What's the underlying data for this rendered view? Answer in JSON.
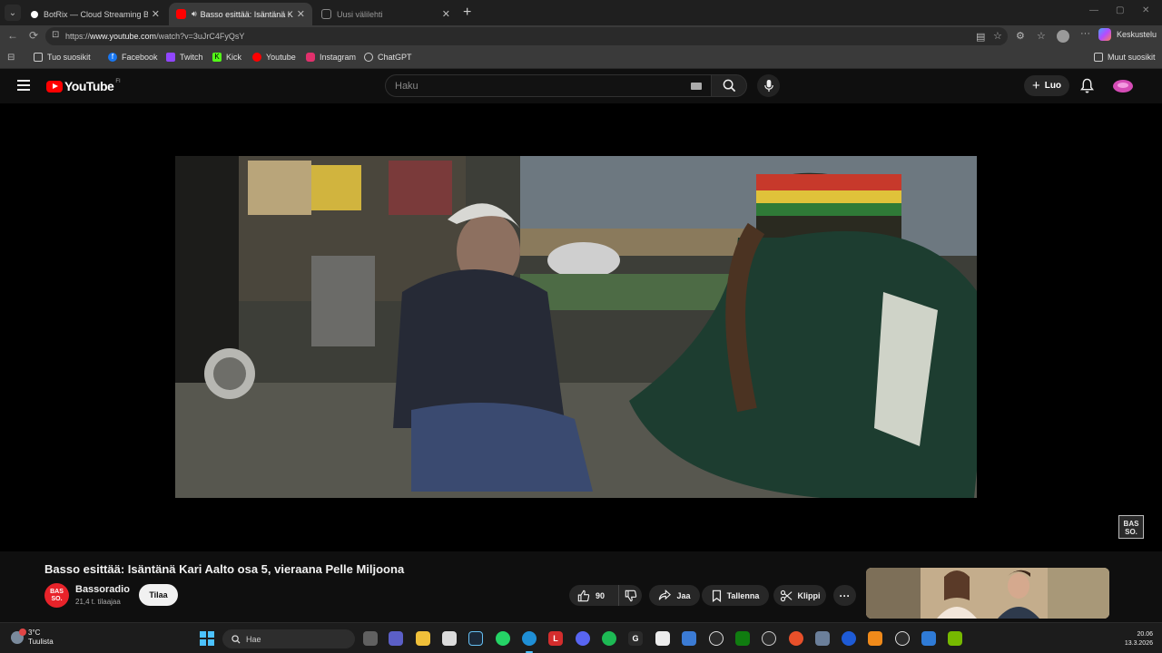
{
  "browser": {
    "tabs": [
      {
        "title": "BotRix — Cloud Streaming Bot fo",
        "favicon_color": "#ffffff",
        "active": false
      },
      {
        "title": "Basso esittää: Isäntänä Kari Aa",
        "favicon_color": "#ff0000",
        "active": true
      },
      {
        "title": "Uusi välilehti",
        "favicon_color": "#888888",
        "active": false
      }
    ],
    "url_prefix": "https://",
    "url_domain": "www.youtube.com",
    "url_path": "/watch?v=3uJrC4FyQsY",
    "copilot_label": "Keskustelu",
    "bookmarks": [
      {
        "label": "Tuo suosikit",
        "icon": "import-icon",
        "color": "#cfcfcf"
      },
      {
        "label": "Facebook",
        "icon": "facebook-icon",
        "color": "#1877f2"
      },
      {
        "label": "Twitch",
        "icon": "twitch-icon",
        "color": "#9146ff"
      },
      {
        "label": "Kick",
        "icon": "kick-icon",
        "color": "#53fc18"
      },
      {
        "label": "Youtube",
        "icon": "youtube-icon",
        "color": "#ff0000"
      },
      {
        "label": "Instagram",
        "icon": "instagram-icon",
        "color": "#e1306c"
      },
      {
        "label": "ChatGPT",
        "icon": "chatgpt-icon",
        "color": "#cfcfcf"
      }
    ],
    "other_favorites": "Muut suosikit"
  },
  "youtube": {
    "logo_text": "YouTube",
    "logo_region": "FI",
    "search_placeholder": "Haku",
    "create_label": "Luo",
    "brand_color": "#ff0000"
  },
  "video": {
    "watermark": [
      "BAS",
      "SO."
    ]
  },
  "meta": {
    "title": "Basso esittää: Isäntänä Kari Aalto osa 5, vieraana Pelle Miljoona",
    "channel_name": "Bassoradio",
    "channel_avatar": [
      "BAS",
      "SO."
    ],
    "subscribers": "21,4 t. tilaajaa",
    "subscribe_label": "Tilaa",
    "like_count": "90",
    "share_label": "Jaa",
    "save_label": "Tallenna",
    "clip_label": "Klippi",
    "more_label": "···"
  },
  "taskbar": {
    "temperature": "3°C",
    "weather_text": "Tuulista",
    "search_label": "Hae",
    "time": "20.06",
    "date": "13.3.2026"
  }
}
